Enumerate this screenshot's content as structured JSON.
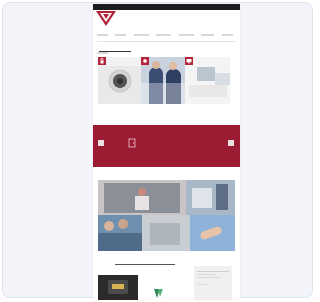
{
  "topbar": {
    "left_text": "",
    "right_text": ""
  },
  "nav": {
    "items": [
      "",
      "",
      "",
      "",
      "",
      "",
      "",
      ""
    ]
  },
  "sections": {
    "categories_title": "",
    "news_title": ""
  },
  "banner": {
    "top_text": "",
    "button_text": ""
  },
  "sidebar": {
    "heading": ""
  },
  "colors": {
    "brand": "#9b1b32",
    "topbar": "#1c1c1c",
    "background": "#f2f4fa",
    "vendor_green": "#2e8b57"
  },
  "icons": [
    "logo-icon",
    "door-icon",
    "speaker-icon",
    "camera-icon",
    "lock-icon",
    "monitor-icon",
    "vendor-logo-icon"
  ]
}
